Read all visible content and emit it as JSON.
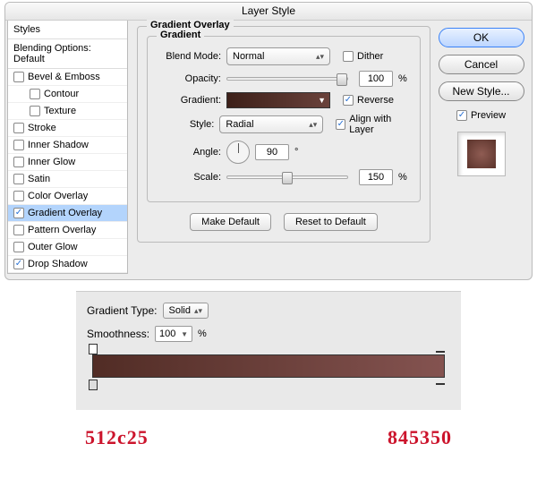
{
  "dialog_title": "Layer Style",
  "sidebar": {
    "header_styles": "Styles",
    "header_blending": "Blending Options: Default",
    "items": [
      {
        "label": "Bevel & Emboss",
        "checked": false
      },
      {
        "label": "Contour",
        "checked": false,
        "sub": true
      },
      {
        "label": "Texture",
        "checked": false,
        "sub": true
      },
      {
        "label": "Stroke",
        "checked": false
      },
      {
        "label": "Inner Shadow",
        "checked": false
      },
      {
        "label": "Inner Glow",
        "checked": false
      },
      {
        "label": "Satin",
        "checked": false
      },
      {
        "label": "Color Overlay",
        "checked": false
      },
      {
        "label": "Gradient Overlay",
        "checked": true,
        "selected": true
      },
      {
        "label": "Pattern Overlay",
        "checked": false
      },
      {
        "label": "Outer Glow",
        "checked": false
      },
      {
        "label": "Drop Shadow",
        "checked": true
      }
    ]
  },
  "panel": {
    "legend_outer": "Gradient Overlay",
    "legend_inner": "Gradient",
    "blend_mode_label": "Blend Mode:",
    "blend_mode_value": "Normal",
    "dither_label": "Dither",
    "dither_checked": false,
    "opacity_label": "Opacity:",
    "opacity_value": "100",
    "pct": "%",
    "gradient_label": "Gradient:",
    "reverse_label": "Reverse",
    "reverse_checked": true,
    "style_label": "Style:",
    "style_value": "Radial",
    "align_label": "Align with Layer",
    "align_checked": true,
    "angle_label": "Angle:",
    "angle_value": "90",
    "deg": "°",
    "scale_label": "Scale:",
    "scale_value": "150",
    "make_default": "Make Default",
    "reset_default": "Reset to Default"
  },
  "right": {
    "ok": "OK",
    "cancel": "Cancel",
    "newstyle": "New Style...",
    "preview_label": "Preview",
    "preview_checked": true
  },
  "grad_editor": {
    "type_label": "Gradient Type:",
    "type_value": "Solid",
    "smooth_label": "Smoothness:",
    "smooth_value": "100",
    "pct": "%",
    "hex_left": "512c25",
    "hex_right": "845350"
  }
}
